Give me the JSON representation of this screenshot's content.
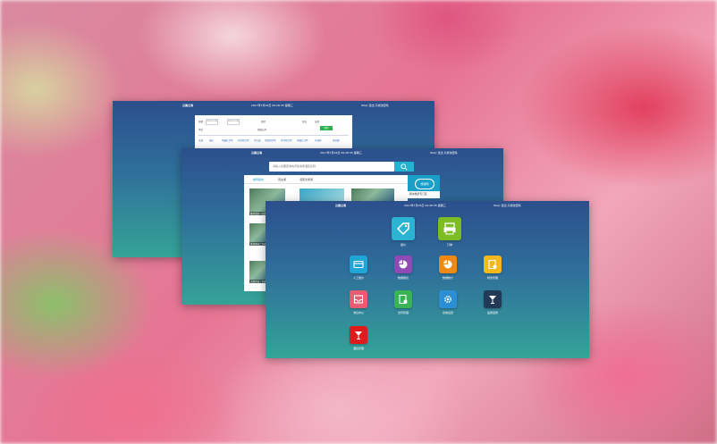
{
  "screens": {
    "back": {
      "title": "云南云海",
      "datetime": "2017年7月26日 09:28:35 星期三",
      "user": "Wsq!  退出  只修改密码",
      "form": {
        "label_date": "日期",
        "date_from": "2017-07-26",
        "date_to": "2017-07-26",
        "label_type": "类型",
        "label_status": "状态",
        "label_unit": "单位",
        "label_company": "所属公司",
        "status_value": "全部",
        "search_button": "搜索"
      },
      "tabs": [
        "全部",
        "报价",
        "已确认订单",
        "已付款订单",
        "已完成",
        "已取消订单",
        "待付款订单",
        "待确认订单",
        "已退款",
        "待处理"
      ]
    },
    "middle": {
      "title": "云南云海",
      "datetime": "2017年7月26日 09:28:35 星期三",
      "user": "Wsq!  退出  只修改密码",
      "search_placeholder": "请输入您要查询的景区或者酒店名称",
      "tabs": [
        "推荐路线",
        "周边游",
        "滇西北旅游"
      ],
      "thumbs": [
        "腾冲温泉一日游",
        "普洱茶园二日游",
        "大理古城三日游"
      ],
      "side_badge": "旅游网",
      "side_text": "腾冲旅游专门店"
    },
    "front": {
      "title": "云南云海",
      "datetime": "2017年7月26日 09:28:35 星期三",
      "user": "Wsq!  退出  只修改密码",
      "apps": [
        {
          "name": "报价",
          "icon": "price-tag-icon",
          "color": "#2bb3d2"
        },
        {
          "name": "订单",
          "icon": "printer-icon",
          "color": "#7cbc25"
        },
        {
          "name": "人工报价",
          "icon": "card-icon",
          "color": "#1fa5d6"
        },
        {
          "name": "数据报表",
          "icon": "pie-chart-icon",
          "color": "#8e4bb5"
        },
        {
          "name": "数据统计",
          "icon": "pie-chart-icon",
          "color": "#ee8a14"
        },
        {
          "name": "财务管理",
          "icon": "document-gear-icon",
          "color": "#f2b81c"
        },
        {
          "name": "消息中心",
          "icon": "inbox-icon",
          "color": "#e95d74"
        },
        {
          "name": "合同管理",
          "icon": "document-gear-icon",
          "color": "#39b356"
        },
        {
          "name": "系统设置",
          "icon": "gear-icon",
          "color": "#2b8fd6"
        },
        {
          "name": "品质监督",
          "icon": "cocktail-icon",
          "color": "#223a55"
        },
        {
          "name": "酒店管理",
          "icon": "cocktail-icon",
          "color": "#e01b1b"
        }
      ]
    }
  }
}
